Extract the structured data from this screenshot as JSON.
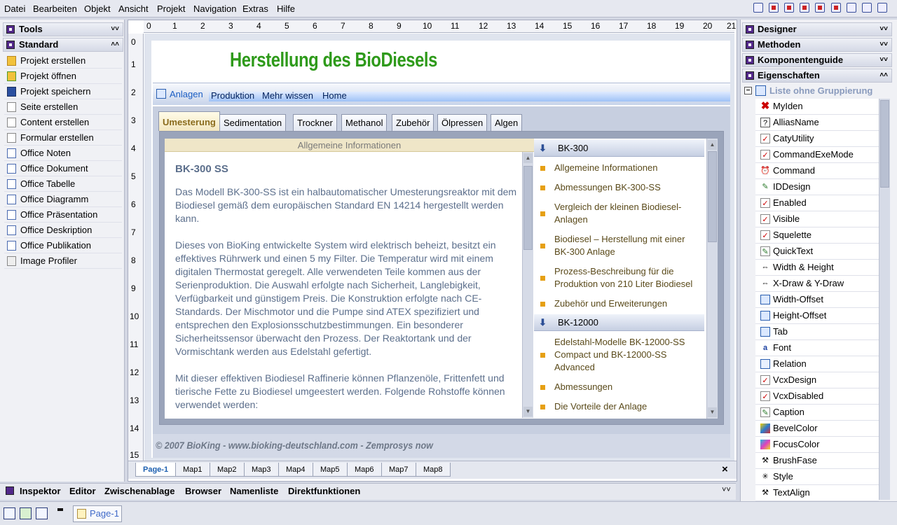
{
  "menu": [
    "Datei",
    "Bearbeiten",
    "Objekt",
    "Ansicht",
    "Projekt",
    "Navigation",
    "Extras",
    "Hilfe"
  ],
  "left_panel": {
    "tools_title": "Tools",
    "standard_title": "Standard",
    "items": [
      "Projekt erstellen",
      "Projekt öffnen",
      "Projekt speichern",
      "Seite erstellen",
      "Content erstellen",
      "Formular erstellen",
      "Office Noten",
      "Office Dokument",
      "Office Tabelle",
      "Office Diagramm",
      "Office Präsentation",
      "Office Deskription",
      "Office Publikation",
      "Image Profiler"
    ]
  },
  "ruler": {
    "h": [
      "0",
      "1",
      "2",
      "3",
      "4",
      "5",
      "6",
      "7",
      "8",
      "9",
      "10",
      "11",
      "12",
      "13",
      "14",
      "15",
      "16",
      "17",
      "18",
      "19",
      "20",
      "21"
    ],
    "v": [
      "0",
      "1",
      "2",
      "3",
      "4",
      "5",
      "6",
      "7",
      "8",
      "9",
      "10",
      "11",
      "12",
      "13",
      "14",
      "15"
    ]
  },
  "page": {
    "title": "Herstellung des BioDiesels",
    "nav": [
      "Anlagen",
      "Produktion",
      "Mehr wissen",
      "Home"
    ],
    "tabs": [
      "Umesterung",
      "Sedimentation",
      "Trockner",
      "Methanol",
      "Zubehör",
      "Ölpressen",
      "Algen"
    ],
    "info_header": "Allgemeine Informationen",
    "info_heading": "BK-300 SS",
    "paragraphs": [
      "Das Modell BK-300-SS ist ein halbautomatischer Umesterungsreaktor mit dem Biodiesel gemäß dem europäischen Standard EN 14214 hergestellt werden kann.",
      "Dieses von BioKing entwickelte System wird elektrisch beheizt, besitzt ein effektives Rührwerk und einen 5 my Filter. Die Temperatur wird mit einem digitalen Thermostat geregelt. Alle verwendeten Teile kommen aus der Serienproduktion. Die Auswahl erfolgte nach Sicherheit, Langlebigkeit, Verfügbarkeit und günstigem Preis. Die Konstruktion erfolgte nach CE-Standards. Der Mischmotor und die Pumpe sind ATEX spezifiziert und entsprechen den Explosionsschutzbestimmungen. Ein besonderer Sicherheitssensor überwacht den Prozess. Der Reaktortank und der Vormischtank werden aus Edelstahl gefertigt.",
      "Mit dieser effektiven Biodiesel Raffinerie können Pflanzenöle, Frittenfett und tierische Fette zu Biodiesel umgeestert werden. Folgende Rohstoffe können verwendet werden:"
    ],
    "group1": {
      "title": "BK-300",
      "items": [
        "Allgemeine Informationen",
        "Abmessungen BK-300-SS",
        "Vergleich der kleinen Biodiesel-Anlagen",
        "Biodiesel – Herstellung mit einer BK-300 Anlage",
        "Prozess-Beschreibung für die Produktion von 210 Liter Biodiesel",
        "Zubehör und Erweiterungen"
      ]
    },
    "group2": {
      "title": "BK-12000",
      "items": [
        "Edelstahl-Modelle BK-12000-SS Compact und BK-12000-SS Advanced",
        "Abmessungen",
        "Die Vorteile der Anlage"
      ]
    },
    "footer": "© 2007 BioKing - www.bioking-deutschland.com - Zemprosys now"
  },
  "map_tabs": [
    "Page-1",
    "Map1",
    "Map2",
    "Map3",
    "Map4",
    "Map5",
    "Map6",
    "Map7",
    "Map8"
  ],
  "close_glyph": "×",
  "right_panel": {
    "sections": [
      "Designer",
      "Methoden",
      "Komponentenguide",
      "Eigenschaften"
    ],
    "group_title": "Liste ohne Gruppierung",
    "props": [
      "MyIden",
      "AlliasName",
      "CatyUtility",
      "CommandExeMode",
      "Command",
      "IDDesign",
      "Enabled",
      "Visible",
      "Squelette",
      "QuickText",
      "Width & Height",
      "X-Draw & Y-Draw",
      "Width-Offset",
      "Height-Offset",
      "Tab",
      "Font",
      "Relation",
      "VcxDesign",
      "VcxDisabled",
      "Caption",
      "BevelColor",
      "FocusColor",
      "BrushFase",
      "Style",
      "TextAlign"
    ]
  },
  "bottom_tabs": [
    "Inspektor",
    "Editor",
    "Zwischenablage",
    "Browser",
    "Namenliste",
    "Direktfunktionen"
  ],
  "status": {
    "page_tab": "Page-1"
  },
  "colors": {
    "title_green": "#2e9a1a",
    "text_blue": "#5c6f8c",
    "accent_panel": "#52288a"
  }
}
